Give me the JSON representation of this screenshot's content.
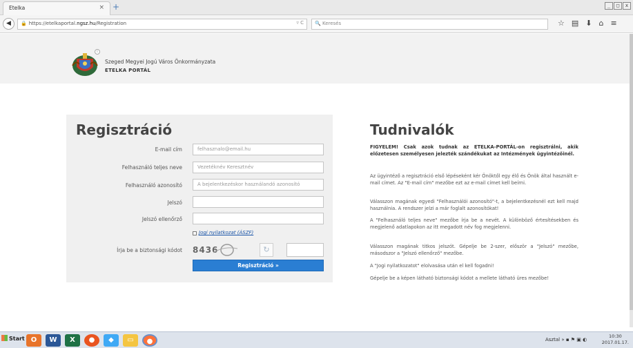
{
  "browser": {
    "tab_title": "Etelka",
    "tab_close": "×",
    "new_tab": "+",
    "url_prefix": "https://etelkaportal.",
    "url_domain": "ngsz.hu",
    "url_path": "/Registration",
    "search_placeholder": "Keresés",
    "window_buttons": [
      "_",
      "□",
      "x"
    ]
  },
  "header": {
    "org_name": "Szeged Megyei Jogú Város Önkormányzata",
    "portal_name": "ETELKA PORTÁL"
  },
  "form": {
    "title": "Regisztráció",
    "fields": [
      {
        "label": "E-mail cím",
        "placeholder": "felhasznalo@email.hu"
      },
      {
        "label": "Felhasználó teljes neve",
        "placeholder": "Vezetéknév Keresztnév"
      },
      {
        "label": "Felhasználó azonosító",
        "placeholder": "A bejelentkezéskor használandó azonosító"
      },
      {
        "label": "Jelszó",
        "placeholder": ""
      },
      {
        "label": "Jelszó ellenőrző",
        "placeholder": ""
      }
    ],
    "terms_link": "Jogi nyilatkozat (ÁSZF)",
    "captcha_label": "Írja be a biztonsági kódot",
    "captcha_text": "8436",
    "submit_label": "Regisztráció »"
  },
  "info": {
    "title": "Tudnivalók",
    "paragraphs": [
      "FIGYELEM! Csak azok tudnak az ETELKA-PORTÁL-on regisztrálni, akik előzetesen személyesen jelezték szándékukat az Intézmények ügyintézőinél.",
      "Az ügyintéző a regisztráció első lépéseként kér Önöktől egy élő és Önök által használt e-mail címet. Az \"E-mail cím\" mezőbe ezt az e-mail címet kell beírni.",
      "Válasszon magának egyedi \"Felhasználói azonosító\"-t, a bejelentkezésnél ezt kell majd használnia. A rendszer jelzi a már foglalt azonosítókat!",
      "A \"Felhasználó teljes neve\" mezőbe írja be a nevét. A különböző értesítésekben és megjelenő adatlapokon az itt megadott név fog megjelenni.",
      "Válasszon magának titkos jelszót. Gépelje be 2-szer, először a \"Jelszó\" mezőbe, másodszor a \"Jelszó ellenőrző\" mezőbe.",
      "A \"Jogi nyilatkozatot\" elolvasása után el kell fogadni!",
      "Gépelje be a képen látható biztonsági kódot a mellete látható üres mezőbe!"
    ]
  },
  "taskbar": {
    "start_label": "Start",
    "desktop_label": "Asztal",
    "time": "10:30",
    "date": "2017.01.17."
  }
}
